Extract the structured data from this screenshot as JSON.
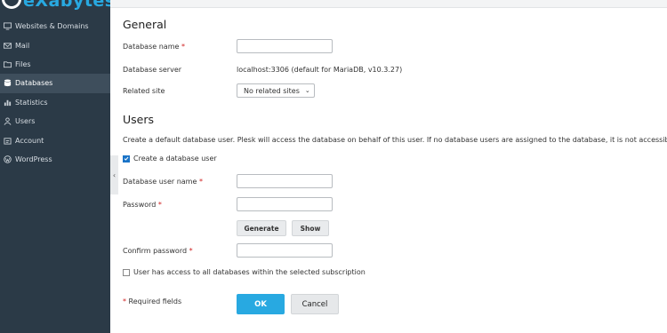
{
  "brand": {
    "name": "eXabytes"
  },
  "sidebar": {
    "items": [
      {
        "label": "Websites & Domains",
        "icon": "monitor-icon",
        "active": false
      },
      {
        "label": "Mail",
        "icon": "mail-icon",
        "active": false
      },
      {
        "label": "Files",
        "icon": "folder-icon",
        "active": false
      },
      {
        "label": "Databases",
        "icon": "database-icon",
        "active": true
      },
      {
        "label": "Statistics",
        "icon": "bar-chart-icon",
        "active": false
      },
      {
        "label": "Users",
        "icon": "user-icon",
        "active": false
      },
      {
        "label": "Account",
        "icon": "account-icon",
        "active": false
      },
      {
        "label": "WordPress",
        "icon": "wordpress-icon",
        "active": false
      }
    ]
  },
  "general": {
    "title": "General",
    "db_name_label": "Database name",
    "db_name_value": "",
    "db_server_label": "Database server",
    "db_server_value": "localhost:3306 (default for MariaDB, v10.3.27)",
    "related_site_label": "Related site",
    "related_site_value": "No related sites"
  },
  "users": {
    "title": "Users",
    "description": "Create a default database user. Plesk will access the database on behalf of this user. If no database users are assigned to the database, it is not accessible.",
    "create_user_label": "Create a database user",
    "create_user_checked": true,
    "username_label": "Database user name",
    "username_value": "",
    "password_label": "Password",
    "password_value": "",
    "generate_label": "Generate",
    "show_label": "Show",
    "confirm_label": "Confirm password",
    "confirm_value": "",
    "all_db_access_label": "User has access to all databases within the selected subscription",
    "all_db_access_checked": false
  },
  "footer": {
    "required_note": "Required fields",
    "required_marker": "*",
    "ok_label": "OK",
    "cancel_label": "Cancel"
  },
  "colors": {
    "sidebar_bg": "#2b3a47",
    "sidebar_active": "#3e4e5c",
    "accent": "#28a9e1",
    "required": "#d02020"
  }
}
